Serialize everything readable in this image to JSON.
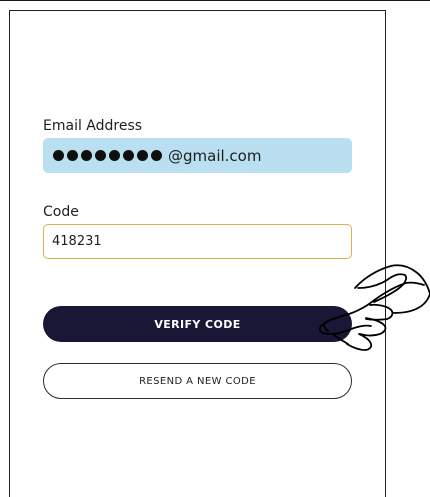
{
  "form": {
    "email_label": "Email Address",
    "email_masked_count": 8,
    "email_domain": "@gmail.com",
    "code_label": "Code",
    "code_value": "418231"
  },
  "buttons": {
    "verify_label": "VERIFY CODE",
    "resend_label": "RESEND A NEW CODE"
  },
  "colors": {
    "email_field_background": "#b9dff0",
    "code_field_border": "#d7b24e",
    "verify_button_background": "#191735"
  },
  "icons": {
    "hand_pointer": "hand-pointer-icon"
  }
}
